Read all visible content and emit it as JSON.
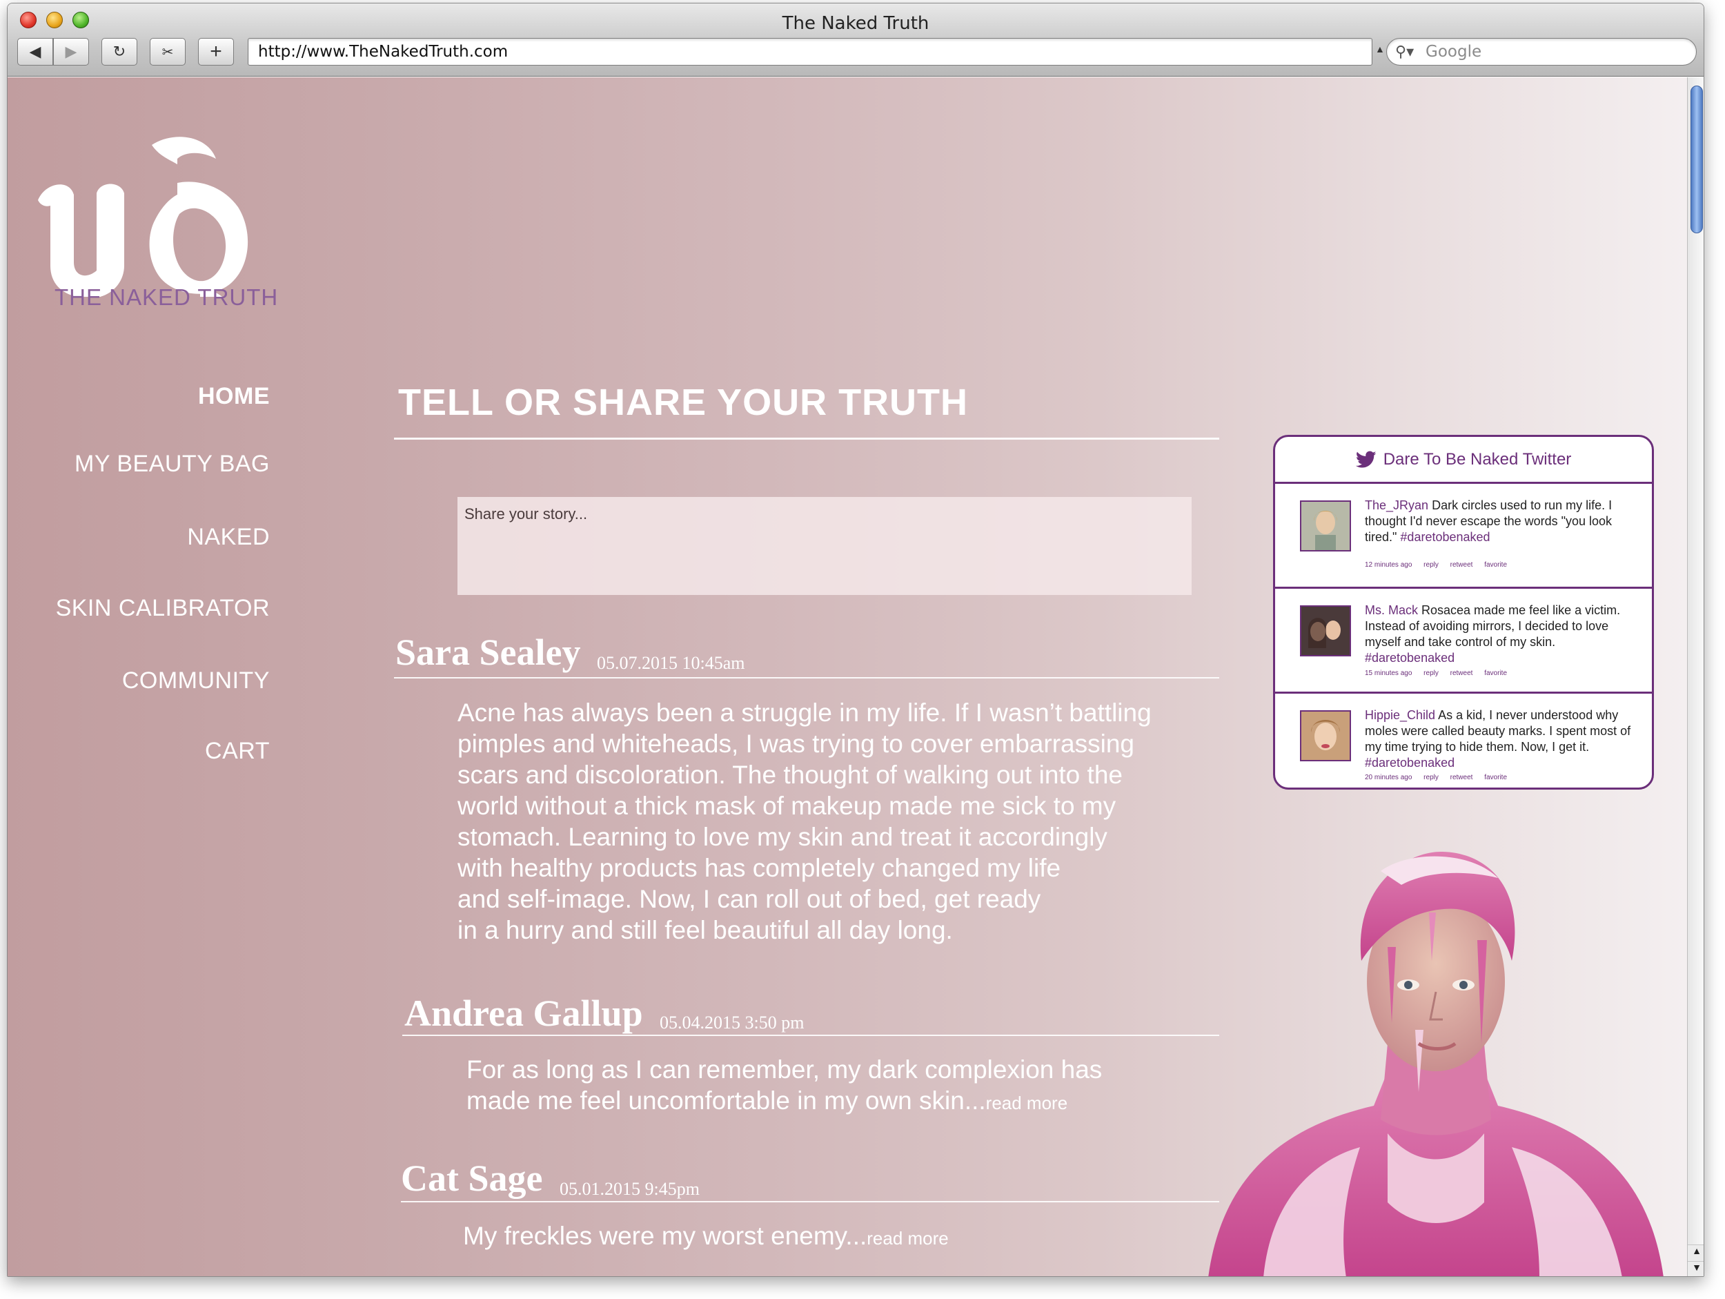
{
  "window": {
    "title": "The Naked Truth"
  },
  "toolbar": {
    "url": "http://www.TheNakedTruth.com",
    "search_placeholder": "Google",
    "back_icon": "back-arrow-icon",
    "forward_icon": "forward-arrow-icon",
    "reload_icon": "reload-icon",
    "snip_icon": "snip-icon",
    "add_icon": "plus-icon"
  },
  "brand": {
    "logo_mark": "ud",
    "tagline": "THE NAKED TRUTH"
  },
  "nav": {
    "items": [
      {
        "label": "HOME",
        "active": true
      },
      {
        "label": "MY BEAUTY BAG",
        "active": false
      },
      {
        "label": "NAKED",
        "active": false
      },
      {
        "label": "SKIN CALIBRATOR",
        "active": false
      },
      {
        "label": "COMMUNITY",
        "active": false
      },
      {
        "label": "CART",
        "active": false
      }
    ]
  },
  "main": {
    "heading": "TELL OR SHARE YOUR TRUTH",
    "story_placeholder": "Share your story...",
    "posts": [
      {
        "name": "Sara Sealey",
        "date": "05.07.2015 10:45am",
        "body": "Acne has always been a struggle in my life. If I wasn’t battling\npimples and whiteheads, I was trying to cover embarrassing\nscars and discoloration. The thought of walking out into the\nworld without a thick mask of makeup made me sick to my\nstomach. Learning to love my skin and treat it accordingly\nwith healthy products has completely changed my life\nand self-image. Now, I can roll out of bed, get ready\nin a hurry and still feel beautiful all day long.",
        "read_more": ""
      },
      {
        "name": "Andrea Gallup",
        "date": "05.04.2015 3:50 pm",
        "body": "For as long as I can remember, my dark complexion has\nmade me feel uncomfortable in my own skin...",
        "read_more": "read more"
      },
      {
        "name": "Cat Sage",
        "date": "05.01.2015 9:45pm",
        "body": "My freckles were my worst enemy...",
        "read_more": "read more"
      }
    ]
  },
  "twitter": {
    "title": "Dare To Be Naked Twitter",
    "icon": "twitter-bird-icon",
    "tweets": [
      {
        "user": "The_JRyan",
        "text": " Dark circles used to run my life. I thought I'd never escape the words \"you look tired.\" ",
        "hashtag": "#daretobenaked",
        "time": "12 minutes ago",
        "actions": [
          "reply",
          "retweet",
          "favorite"
        ]
      },
      {
        "user": "Ms. Mack",
        "text": " Rosacea made me feel like a victim. Instead of avoiding mirrors, I decided to love myself and take control of my skin. ",
        "hashtag": "#daretobenaked",
        "time": "15 minutes ago",
        "actions": [
          "reply",
          "retweet",
          "favorite"
        ]
      },
      {
        "user": "Hippie_Child",
        "text": " As a kid, I never understood why moles were called beauty marks. I spent most of my time trying to hide them. Now, I get it. ",
        "hashtag": "#daretobenaked",
        "time": "20 minutes ago",
        "actions": [
          "reply",
          "retweet",
          "favorite"
        ]
      }
    ]
  },
  "colors": {
    "accent_purple": "#6b2f7a",
    "tagline_purple": "#8a5f9a",
    "bg_left": "#c19d9f",
    "bg_right": "#f4eff0"
  }
}
